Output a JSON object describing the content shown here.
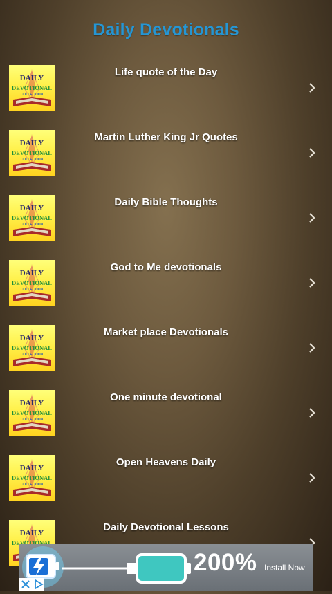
{
  "app": {
    "title": "Daily Devotionals",
    "title_color": "#2596d4"
  },
  "thumbnail": {
    "line1": "DAILY",
    "line2": "DEVOTIONAL",
    "line3": "COLLECTION"
  },
  "list": {
    "items": [
      {
        "label": "Life quote of the Day"
      },
      {
        "label": "Martin Luther King Jr Quotes"
      },
      {
        "label": "Daily Bible Thoughts"
      },
      {
        "label": "God to Me devotionals"
      },
      {
        "label": "Market place Devotionals"
      },
      {
        "label": "One minute devotional"
      },
      {
        "label": "Open Heavens Daily"
      },
      {
        "label": "Daily Devotional Lessons"
      }
    ],
    "chevron_icon": "chevron-right-icon"
  },
  "ad": {
    "percent": "200%",
    "install": "Install Now",
    "icons": [
      "battery-icon",
      "close-icon",
      "adchoices-icon"
    ]
  }
}
